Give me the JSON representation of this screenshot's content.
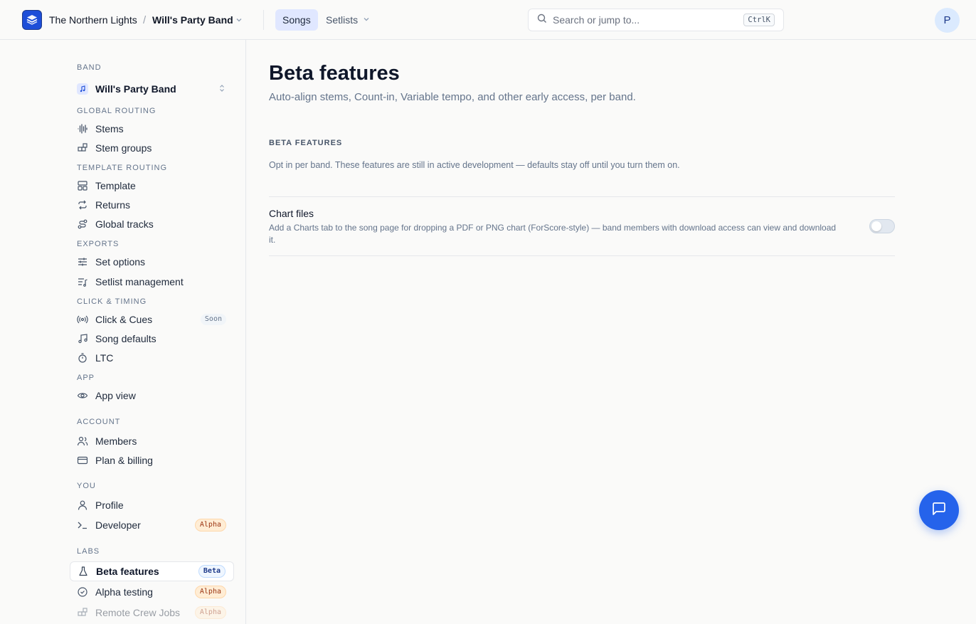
{
  "header": {
    "org_name": "The Northern Lights",
    "separator": "/",
    "band_name": "Will's Party Band",
    "nav": {
      "songs": "Songs",
      "setlists": "Setlists"
    },
    "search": {
      "placeholder": "Search or jump to...",
      "shortcut": "CtrlK"
    },
    "avatar_initial": "P"
  },
  "sidebar": {
    "band_section": "BAND",
    "band_selector": "Will's Party Band",
    "sections": {
      "global_routing": "GLOBAL ROUTING",
      "template_routing": "TEMPLATE ROUTING",
      "exports": "EXPORTS",
      "click_timing": "CLICK & TIMING",
      "app": "APP",
      "account": "ACCOUNT",
      "you": "YOU",
      "labs": "LABS"
    },
    "items": {
      "stems": "Stems",
      "stem_groups": "Stem groups",
      "template": "Template",
      "returns": "Returns",
      "global_tracks": "Global tracks",
      "set_options": "Set options",
      "setlist_management": "Setlist management",
      "click_cues": "Click & Cues",
      "song_defaults": "Song defaults",
      "ltc": "LTC",
      "app_view": "App view",
      "members": "Members",
      "plan_billing": "Plan & billing",
      "profile": "Profile",
      "developer": "Developer",
      "beta_features": "Beta features",
      "alpha_testing": "Alpha testing",
      "remote_crew_jobs": "Remote Crew Jobs"
    },
    "badges": {
      "soon": "Soon",
      "alpha": "Alpha",
      "beta": "Beta"
    }
  },
  "main": {
    "title": "Beta features",
    "subtitle": "Auto-align stems, Count-in, Variable tempo, and other early access, per band.",
    "section_heading": "BETA FEATURES",
    "section_description": "Opt in per band. These features are still in active development — defaults stay off until you turn them on.",
    "features": [
      {
        "title": "Chart files",
        "description": "Add a Charts tab to the song page for dropping a PDF or PNG chart (ForScore-style) — band members with download access can view and download it.",
        "enabled": false
      }
    ]
  },
  "colors": {
    "accent": "#2563eb",
    "brand": "#1d4ed8"
  }
}
